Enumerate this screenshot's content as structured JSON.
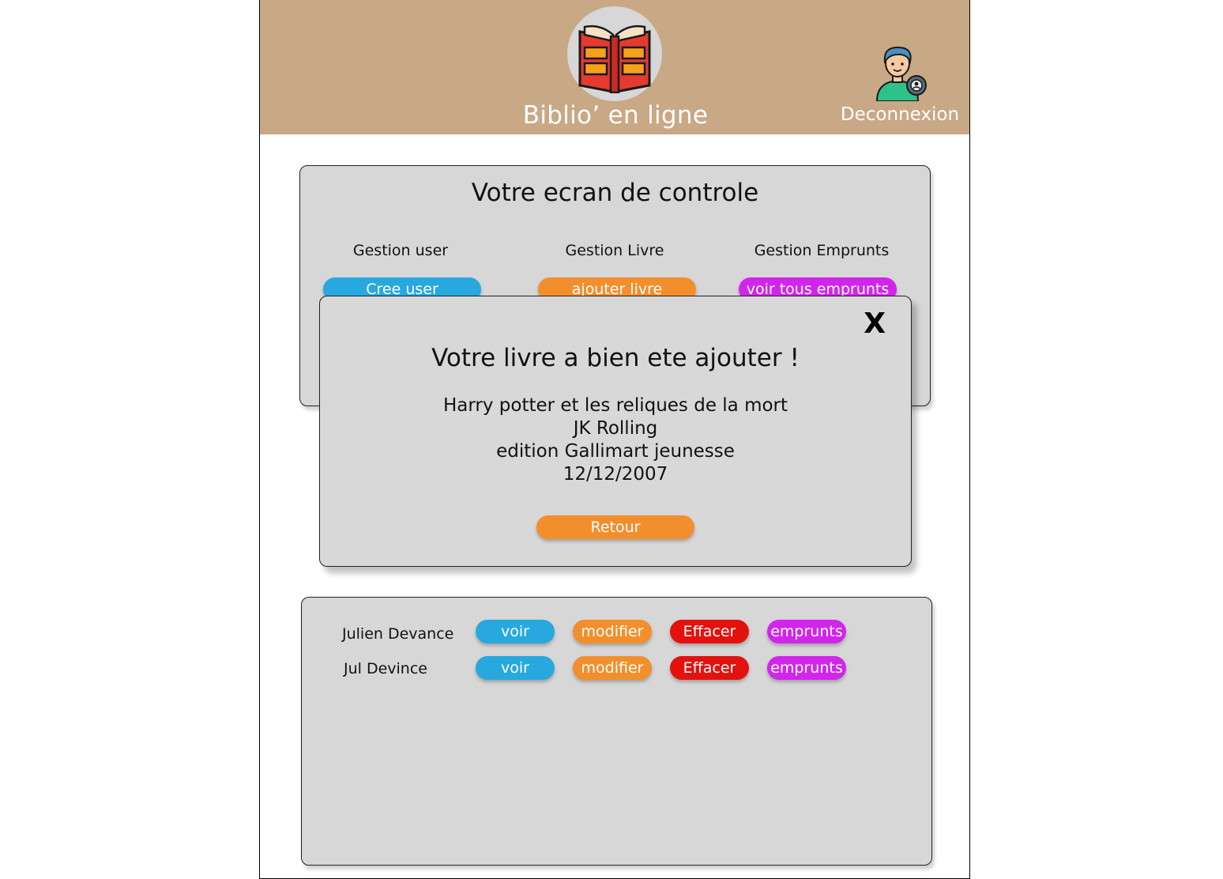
{
  "header": {
    "site_title": "Biblio’ en ligne",
    "logout_label": "Deconnexion",
    "logo_icon": "open-book-icon",
    "user_icon": "user-avatar-icon"
  },
  "control": {
    "title": "Votre ecran de controle",
    "columns": [
      {
        "label": "Gestion user",
        "button": "Cree user",
        "color": "#27a8df"
      },
      {
        "label": "Gestion Livre",
        "button": "ajouter livre",
        "color": "#f28f2c"
      },
      {
        "label": "Gestion Emprunts",
        "button": "voir tous emprunts",
        "color": "#d125ec"
      }
    ]
  },
  "modal": {
    "close_label": "X",
    "title": "Votre livre a bien ete ajouter !",
    "book": {
      "title": "Harry potter et les reliques de la mort",
      "author": "JK Rolling",
      "publisher": "edition Gallimart jeunesse",
      "date": "12/12/2007"
    },
    "back_label": "Retour"
  },
  "users": {
    "rows": [
      {
        "name": "Julien Devance",
        "view": "voir",
        "edit": "modifier",
        "delete": "Effacer",
        "loans": "emprunts"
      },
      {
        "name": "Jul Devince",
        "view": "voir",
        "edit": "modifier",
        "delete": "Effacer",
        "loans": "emprunts"
      }
    ]
  },
  "colors": {
    "header_bg": "#c9a886",
    "panel_bg": "#d7d7d7",
    "blue": "#27a8df",
    "orange": "#f28f2c",
    "red": "#e3120f",
    "magenta": "#d125ec"
  }
}
